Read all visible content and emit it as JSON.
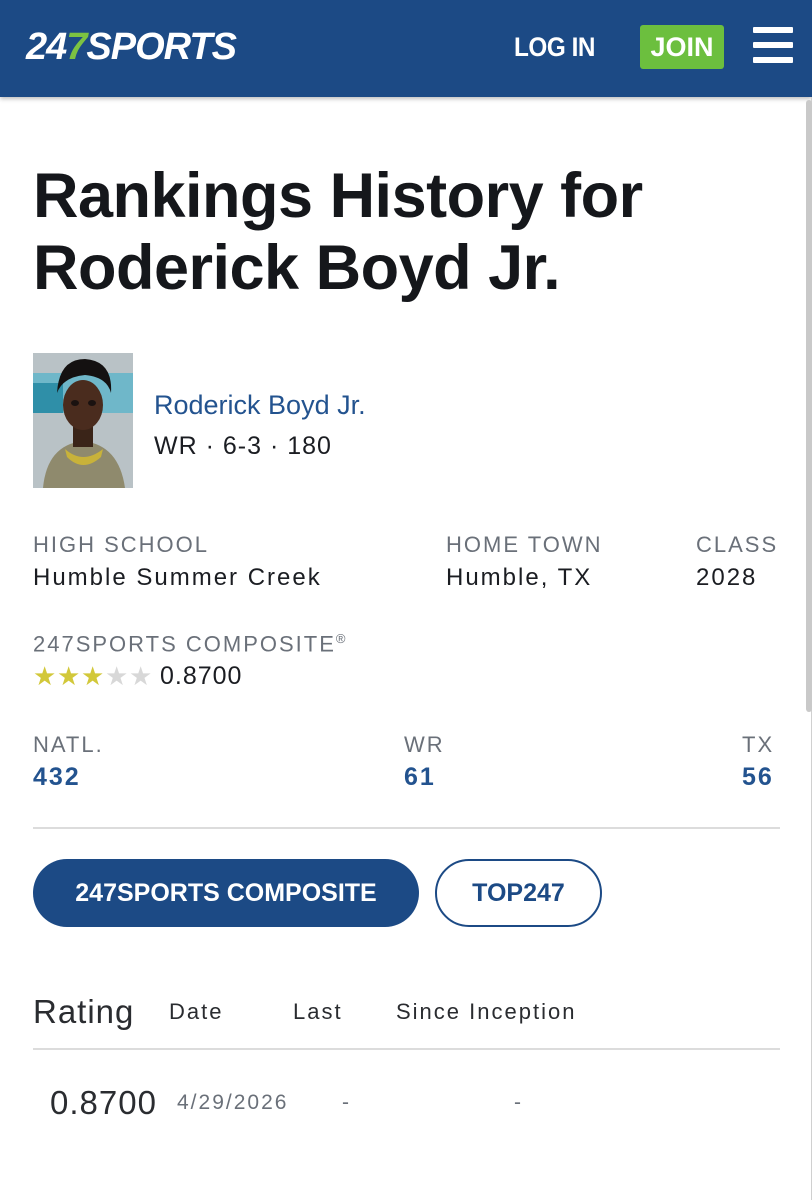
{
  "header": {
    "logo": {
      "part1": "24",
      "part2": "7",
      "part3": "SPORTS"
    },
    "login_label": "LOG IN",
    "join_label": "JOIN",
    "colors": {
      "bar": "#1c4a85",
      "join": "#6cbf3e",
      "logo_accent": "#7cc242"
    }
  },
  "page": {
    "title": "Rankings History for Roderick Boyd Jr."
  },
  "player": {
    "name": "Roderick Boyd Jr.",
    "meta": "WR · 6-3 · 180",
    "avatar_icon": "player-photo"
  },
  "bio": {
    "high_school": {
      "label": "HIGH SCHOOL",
      "value": "Humble Summer Creek"
    },
    "home_town": {
      "label": "HOME TOWN",
      "value": "Humble, TX"
    },
    "class": {
      "label": "CLASS",
      "value": "2028"
    }
  },
  "composite": {
    "label": "247SPORTS COMPOSITE",
    "mark": "®",
    "stars_filled": 3,
    "stars_total": 5,
    "rating": "0.8700"
  },
  "ranks": {
    "natl": {
      "label": "NATL.",
      "value": "432"
    },
    "position": {
      "label": "WR",
      "value": "61"
    },
    "state": {
      "label": "TX",
      "value": "56"
    }
  },
  "tabs": {
    "composite": "247SPORTS COMPOSITE",
    "top247": "TOP247"
  },
  "table": {
    "headers": {
      "rating": "Rating",
      "date": "Date",
      "last": "Last",
      "since": "Since Inception"
    },
    "rows": [
      {
        "rating": "0.8700",
        "date": "4/29/2026",
        "last": "-",
        "since": "-"
      }
    ]
  }
}
